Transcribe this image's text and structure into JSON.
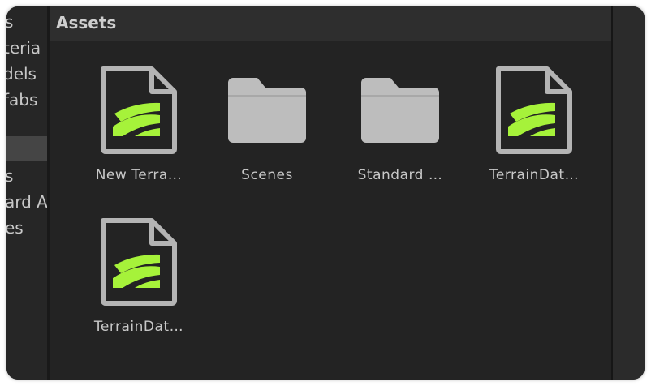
{
  "left_tree": {
    "items": [
      {
        "label": "s"
      },
      {
        "label": "teria"
      },
      {
        "label": "dels"
      },
      {
        "label": "fabs"
      },
      {
        "label": "s"
      },
      {
        "label": "ard A"
      },
      {
        "label": "es"
      }
    ]
  },
  "assets_panel": {
    "title": "Assets",
    "items": [
      {
        "label": "New Terra…",
        "icon": "terrain-file-icon"
      },
      {
        "label": "Scenes",
        "icon": "folder-icon"
      },
      {
        "label": "Standard …",
        "icon": "folder-icon"
      },
      {
        "label": "TerrainDat…",
        "icon": "terrain-file-icon"
      },
      {
        "label": "TerrainDat…",
        "icon": "terrain-file-icon"
      }
    ]
  },
  "colors": {
    "background": "#232323",
    "terrain_green": "#a6f23a",
    "icon_gray": "#b4b4b4"
  }
}
